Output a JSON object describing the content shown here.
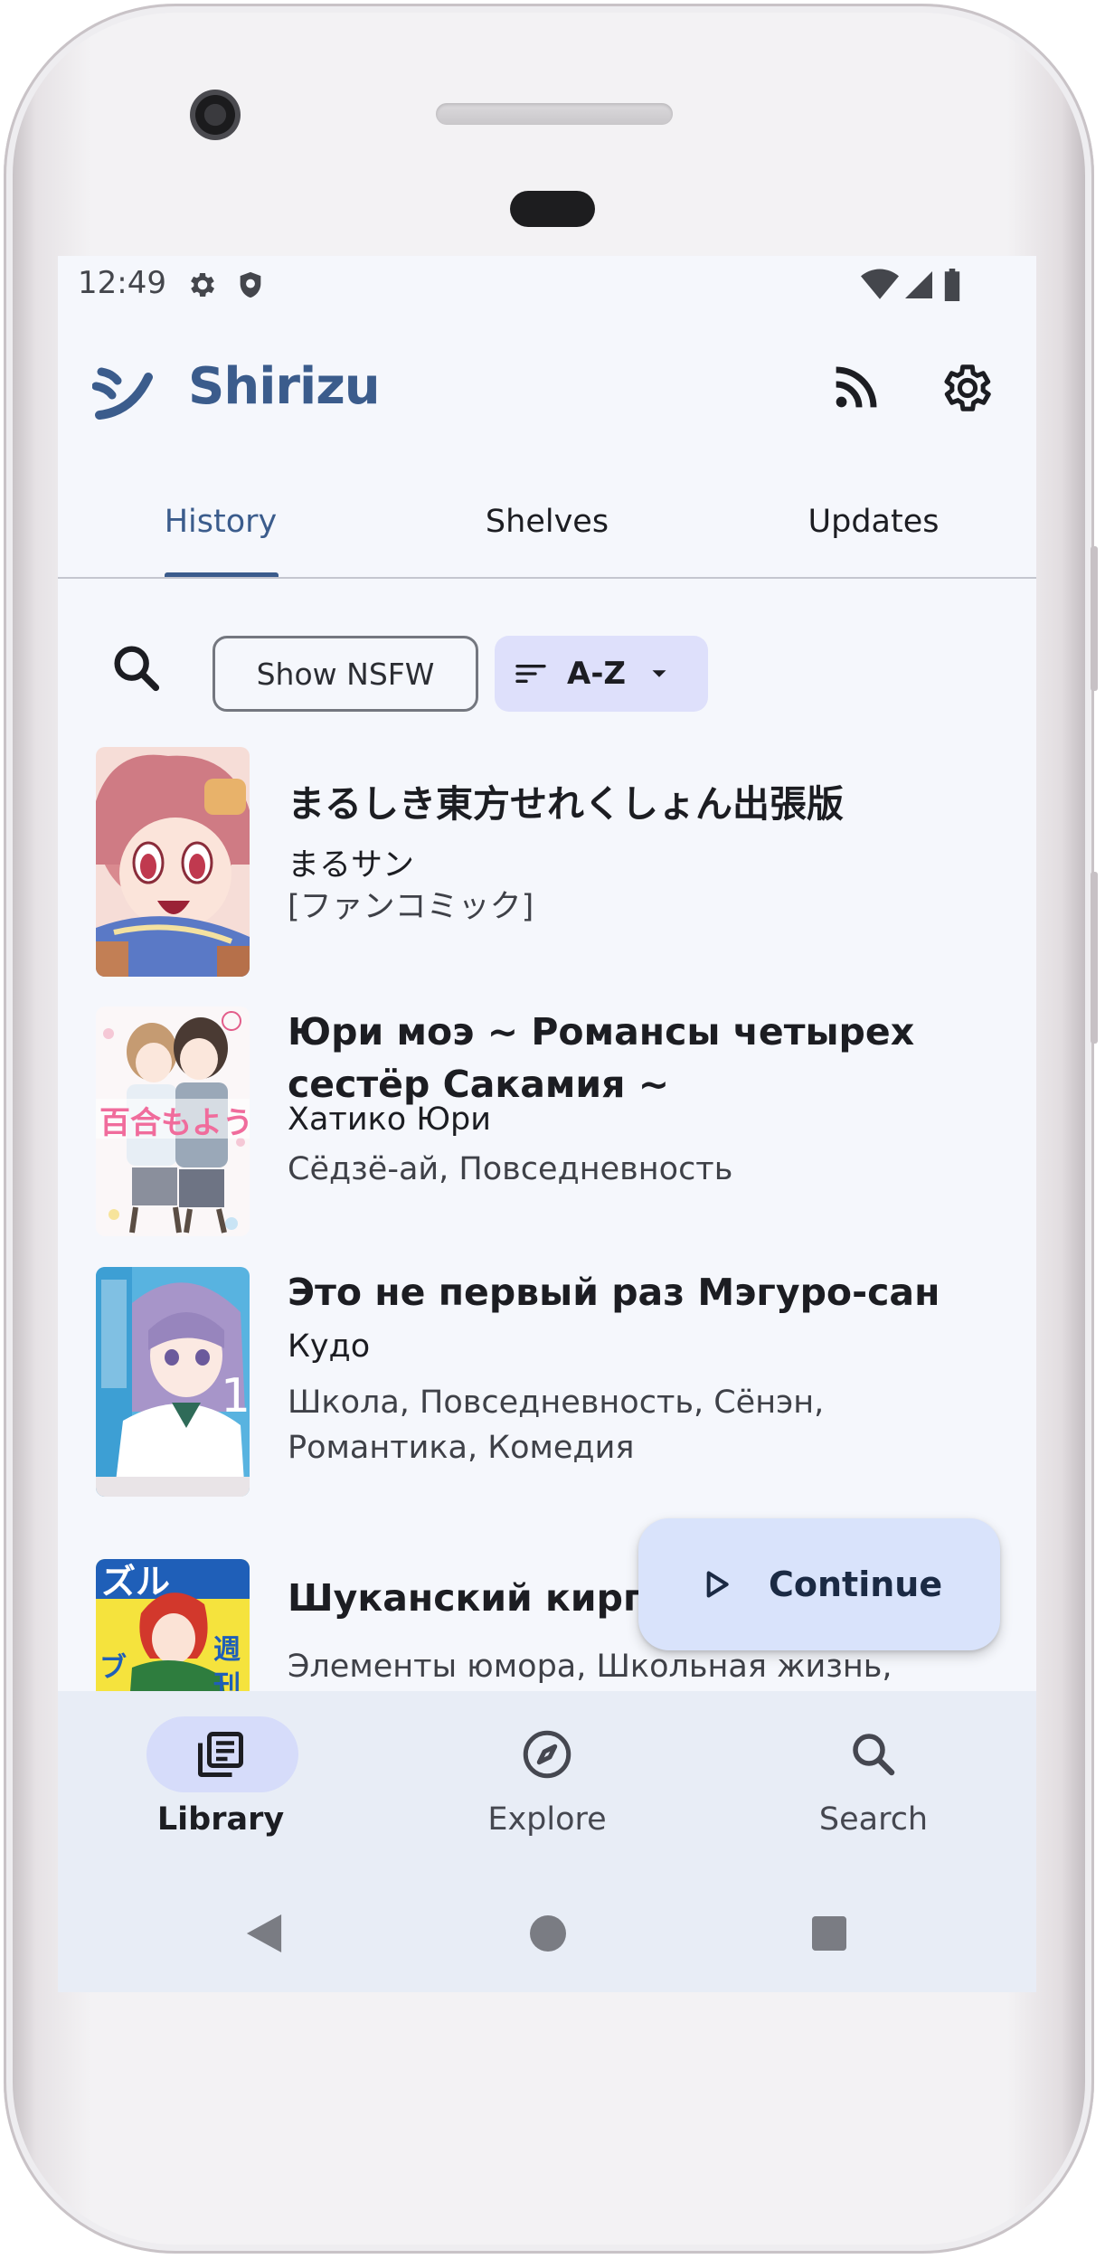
{
  "status_bar": {
    "time": "12:49",
    "left_icons": [
      "gear-icon",
      "shield-icon"
    ],
    "right_icons": [
      "wifi-icon",
      "signal-icon",
      "battery-icon"
    ]
  },
  "app_bar": {
    "logo_text": "シ",
    "title": "Shirizu",
    "actions": [
      "rss-icon",
      "settings-icon"
    ]
  },
  "tabs": [
    {
      "label": "History",
      "active": true
    },
    {
      "label": "Shelves",
      "active": false
    },
    {
      "label": "Updates",
      "active": false
    }
  ],
  "filters": {
    "nsfw_label": "Show NSFW",
    "sort_label": "A-Z"
  },
  "items": [
    {
      "title": "まるしき東方せれくしょん出張版",
      "author": "まるサン",
      "tags": "[ファンコミック]"
    },
    {
      "title": "Юри моэ ~ Романсы четырех сестёр Сакамия ~",
      "author": "Хатико Юри",
      "tags": "Сёдзё-ай, Повседневность"
    },
    {
      "title": "Это не первый раз Мэгуро-сан",
      "author": "Кудо",
      "tags": "Школа, Повседневность, Сёнэн, Романтика, Комедия"
    },
    {
      "title": "Шуканский кирпич",
      "author": "",
      "tags": "Элементы юмора, Школьная жизнь,"
    }
  ],
  "fab": {
    "label": "Continue",
    "icon": "play-icon"
  },
  "bottom_nav": [
    {
      "label": "Library",
      "icon": "library-icon",
      "active": true
    },
    {
      "label": "Explore",
      "icon": "compass-icon",
      "active": false
    },
    {
      "label": "Search",
      "icon": "search-icon",
      "active": false
    }
  ],
  "colors": {
    "primary": "#3b5c8c",
    "background": "#f5f7fc",
    "nav_background": "#e8edf6",
    "fab_background": "#d9e3fb",
    "sort_chip_background": "#dee0fb"
  }
}
